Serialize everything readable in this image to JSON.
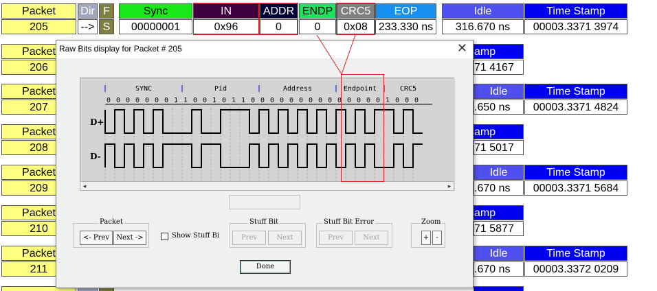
{
  "header": {
    "packet": "Packet",
    "dir": "Dir",
    "f": "F",
    "sync": "Sync",
    "in": "IN",
    "addr": "ADDR",
    "endp": "ENDP",
    "crc5": "CRC5",
    "eop": "EOP",
    "idle": "Idle",
    "timestamp": "Time Stamp"
  },
  "row205": {
    "packet": "205",
    "dir": "-->",
    "f": "S",
    "sync": "00000001",
    "pid": "0x96",
    "addr": "0",
    "endp": "0",
    "crc5": "0x08",
    "eop": "233.330 ns",
    "idle": "316.670 ns",
    "timestamp": "00003.3371 3974"
  },
  "rows": [
    {
      "packet": "Packet",
      "num": "206",
      "idle_or_ts_header": "amp",
      "ts_value": "71 4167"
    },
    {
      "packet": "Packet",
      "num": "207",
      "idle": "Idle",
      "ts": "Time Stamp",
      "idle_value": ".650 ns",
      "ts_value": "00003.3371 4824"
    },
    {
      "packet": "Packet",
      "num": "208",
      "idle_or_ts_header": "amp",
      "ts_value": "71 5017"
    },
    {
      "packet": "Packet",
      "num": "209",
      "idle": "Idle",
      "ts": "Time Stamp",
      "idle_value": ".670 ns",
      "ts_value": "00003.3371 5684"
    },
    {
      "packet": "Packet",
      "num": "210",
      "idle_or_ts_header": "amp",
      "ts_value": "71 5877"
    },
    {
      "packet": "Packet",
      "num": "211",
      "idle": "Idle",
      "ts": "Time Stamp",
      "idle_value": ".670 ns",
      "ts_value": "00003.3372 0209"
    }
  ],
  "dialog": {
    "title": "Raw Bits display for Packet # 205",
    "close": "✕",
    "fields": [
      "SYNC",
      "Pid",
      "Address",
      "Endpoint",
      "CRC5"
    ],
    "bits": "0 0 0 0 0 0 0 1 1 0 0 1 0 1 1 0 0 0 0 0 0 0 0 0 0 0 0 0 0 1 0 0 0",
    "d_plus": "D+",
    "d_minus": "D-",
    "packet_group": "Packet",
    "prev": "<- Prev",
    "next": "Next ->",
    "show_stuff": "Show Stuff Bi",
    "stuff_bit_group": "Stuff Bit",
    "stuff_prev": "Prev",
    "stuff_next": "Next",
    "stuff_err_group": "Stuff Bit Error",
    "err_prev": "Prev",
    "err_next": "Next",
    "zoom_group": "Zoom",
    "zoom_in": "+",
    "zoom_out": "-",
    "done": "Done"
  },
  "colors": {
    "sync": "#18e818",
    "in": "#400040",
    "addr": "#000038",
    "endp": "#20e060",
    "crc5": "#808080",
    "eop": "#1890f0",
    "idle": "#5050f0",
    "timestamp": "#0000f0",
    "packet": "#ffff80",
    "highlight": "#e02020"
  }
}
